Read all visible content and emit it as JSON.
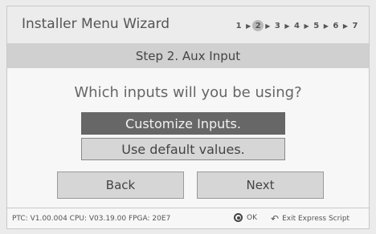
{
  "header": {
    "title": "Installer Menu Wizard",
    "steps": [
      "1",
      "2",
      "3",
      "4",
      "5",
      "6",
      "7"
    ],
    "active_step": 2
  },
  "step_bar": {
    "label": "Step 2. Aux Input"
  },
  "question": "Which inputs will you be using?",
  "options": [
    {
      "label": "Customize Inputs.",
      "selected": true
    },
    {
      "label": "Use default values.",
      "selected": false
    }
  ],
  "nav": {
    "back_label": "Back",
    "next_label": "Next"
  },
  "footer": {
    "firmware": "PTC: V1.00.004 CPU: V03.19.00 FPGA: 20E7",
    "ok_label": "OK",
    "exit_label": "Exit Express Script"
  },
  "colors": {
    "selected_option": "#676767",
    "button_face": "#d6d6d6",
    "step_bar": "#d0d0d0"
  },
  "icons": {
    "ok": "ok-button-icon",
    "exit": "return-arrow-icon"
  }
}
